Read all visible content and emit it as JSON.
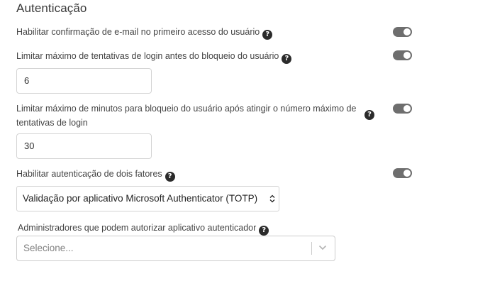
{
  "section": {
    "title": "Autenticação"
  },
  "settings": [
    {
      "label": "Habilitar confirmação de e-mail no primeiro acesso do usuário",
      "help": "?",
      "enabled": true
    },
    {
      "label": "Limitar máximo de tentativas de login antes do bloqueio do usuário",
      "help": "?",
      "enabled": true,
      "value": "6"
    },
    {
      "label_line1": "Limitar máximo de minutos para bloqueio do usuário após atingir o número máximo de",
      "label_line2": "tentativas de login",
      "help": "?",
      "enabled": true,
      "value": "30"
    },
    {
      "label": "Habilitar autenticação de dois fatores",
      "help": "?",
      "enabled": true,
      "selected": "Validação por aplicativo Microsoft Authenticator (TOTP)"
    }
  ],
  "admins": {
    "label": "Administradores que podem autorizar aplicativo autenticador",
    "help": "?",
    "placeholder": "Selecione..."
  },
  "colors": {
    "toggle_on": "#6e6e6e",
    "help_icon": "#2b2b2b"
  }
}
